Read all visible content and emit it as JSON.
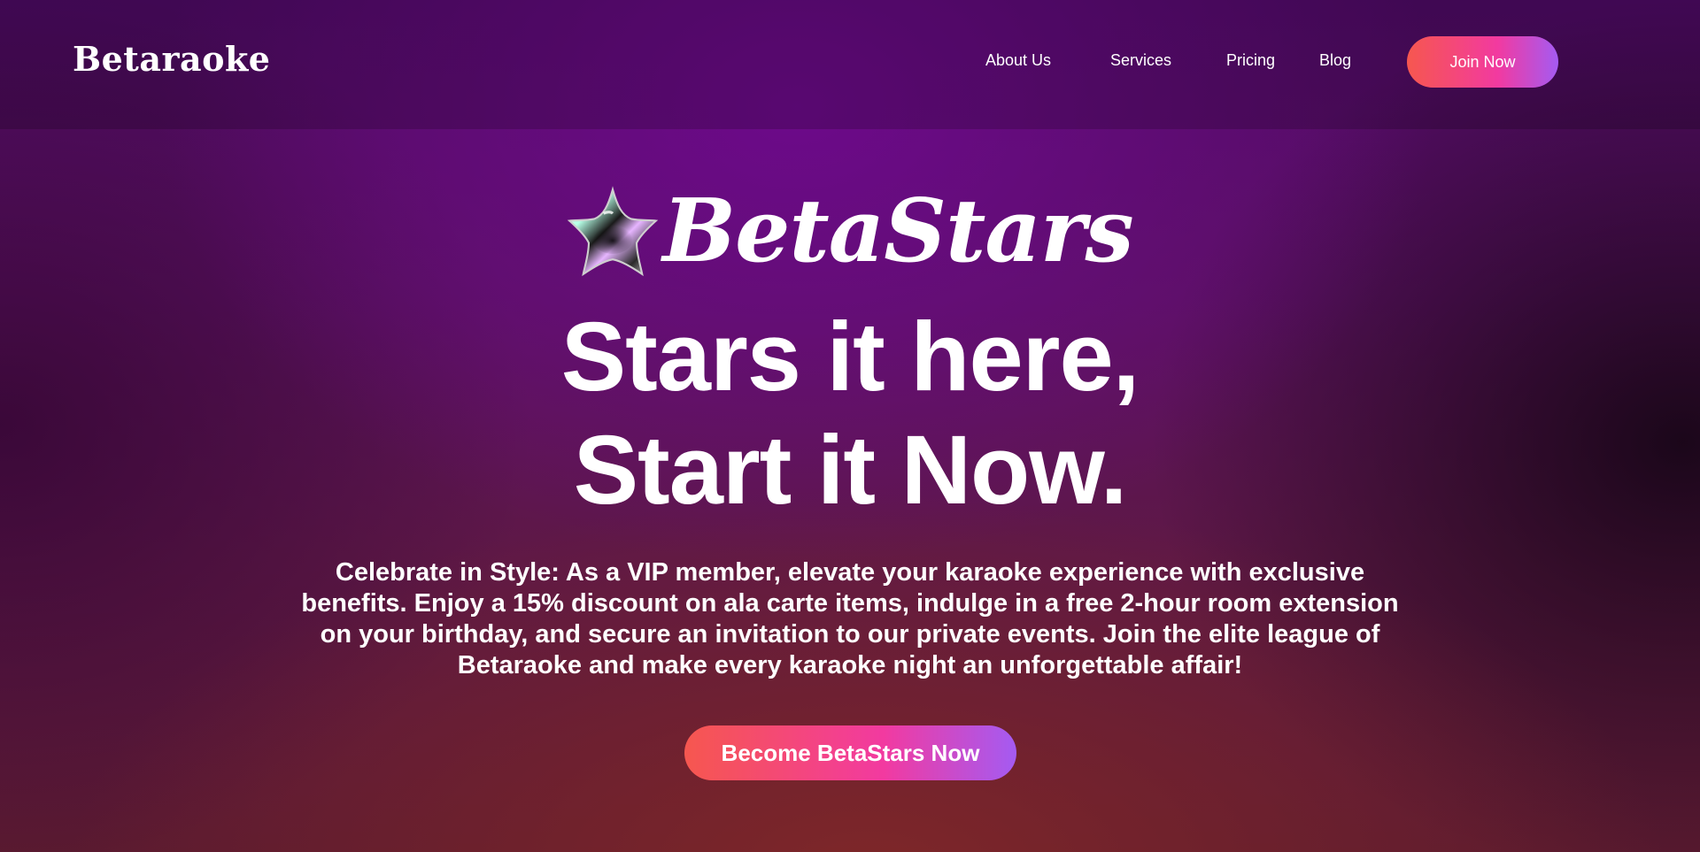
{
  "header": {
    "logo": "Betaraoke",
    "nav": [
      {
        "label": "About Us"
      },
      {
        "label": "Services"
      },
      {
        "label": "Pricing"
      },
      {
        "label": "Blog"
      }
    ],
    "cta_label": "Join Now"
  },
  "hero": {
    "brand_icon": "chrome-star-icon",
    "brand_name": "BetaStars",
    "headline_line1": "Stars it here,",
    "headline_line2": "Start it Now.",
    "description": "Celebrate in Style: As a VIP member, elevate your karaoke experience with exclusive benefits. Enjoy a 15% discount on ala carte items, indulge in a free 2-hour room extension on your birthday, and secure an invitation to our private events. Join the elite league of Betaraoke and make every karaoke night an unforgettable affair!",
    "cta_label": "Become BetaStars Now"
  },
  "colors": {
    "button_gradient_start": "#f6574f",
    "button_gradient_mid": "#f23aa0",
    "button_gradient_end": "#a45bf2",
    "background_top": "#4f0a66",
    "background_bottom": "#5a1a30"
  }
}
